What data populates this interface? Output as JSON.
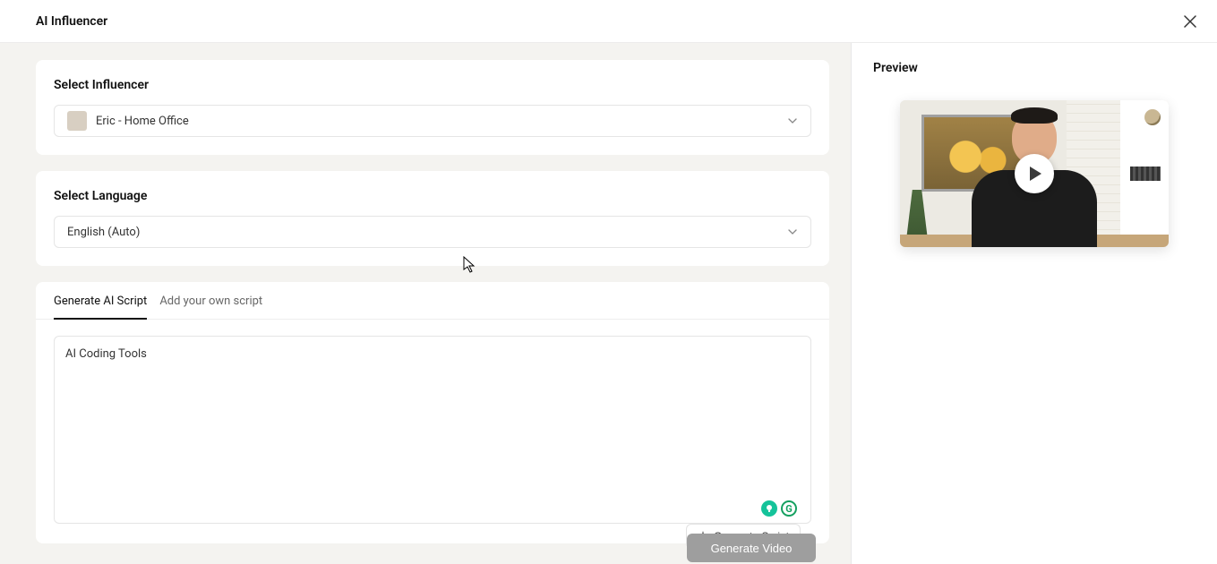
{
  "header": {
    "title": "AI Influencer"
  },
  "influencer": {
    "section_label": "Select Influencer",
    "selected": "Eric - Home Office"
  },
  "language": {
    "section_label": "Select Language",
    "selected": "English (Auto)"
  },
  "script": {
    "tabs": {
      "generate": "Generate AI Script",
      "own": "Add your own script"
    },
    "text": "AI Coding Tools",
    "generate_button": "Generate Script"
  },
  "preview": {
    "title": "Preview"
  },
  "actions": {
    "generate_video": "Generate Video"
  },
  "icons": {
    "grammarly_letter": "G"
  }
}
